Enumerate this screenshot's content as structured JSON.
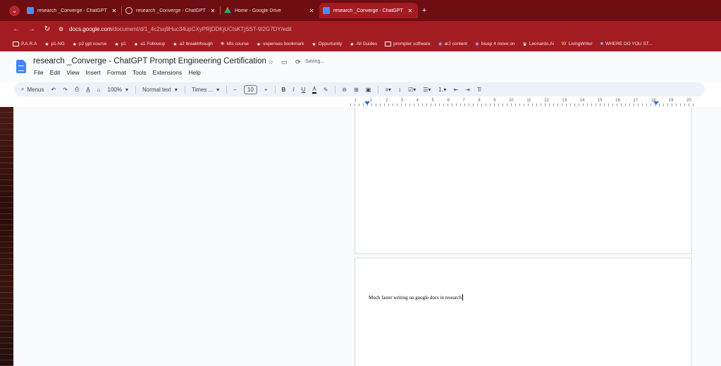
{
  "browser": {
    "tabs": [
      {
        "title": "research _Converge - ChatGPT",
        "icon": "docs-icon",
        "active": false
      },
      {
        "title": "research _Converge - ChatGPT",
        "icon": "globe-icon",
        "active": false
      },
      {
        "title": "Home - Google Drive",
        "icon": "drive-icon",
        "active": false
      },
      {
        "title": "research _Converge - ChatGPT",
        "icon": "docs-icon",
        "active": true
      }
    ],
    "new_tab_label": "+",
    "close_label": "✕",
    "url_host": "docs.google.com",
    "url_path": "/document/d/1_4c2sq9Huc34upCXyPRjDDKjUCtsKTjSST-9I2G7DY/edit",
    "bookmarks": [
      {
        "label": "P.A.R.A",
        "icon": "folder-icon"
      },
      {
        "label": "p1-NG",
        "icon": "star-icon"
      },
      {
        "label": "p2 gpt course",
        "icon": "star-icon"
      },
      {
        "label": "p1",
        "icon": "star-icon"
      },
      {
        "label": "a1 Followup",
        "icon": "star-icon"
      },
      {
        "label": "a2 breaktrhough",
        "icon": "star-icon"
      },
      {
        "label": "k8s course",
        "icon": "k8s-icon"
      },
      {
        "label": "expenses bookmark",
        "icon": "star-icon"
      },
      {
        "label": "Oppurtunity",
        "icon": "star-icon"
      },
      {
        "label": "All Guides",
        "icon": "star-icon"
      },
      {
        "label": "prompter software",
        "icon": "folder-icon"
      },
      {
        "label": "ar2 content",
        "icon": "gear-icon"
      },
      {
        "label": "bicep 4 move on",
        "icon": "gear-icon"
      },
      {
        "label": "Leonardo.Ai",
        "icon": "leonardo-icon"
      },
      {
        "label": "LivingWriter",
        "icon": "livingwriter-icon"
      },
      {
        "label": "WHERE DO YOU ST...",
        "icon": "chat-icon"
      }
    ]
  },
  "docs": {
    "title": "research _Converge -  ChatGPT Prompt  Engineering Certification",
    "status": "Saving...",
    "menu": [
      "File",
      "Edit",
      "View",
      "Insert",
      "Format",
      "Tools",
      "Extensions",
      "Help"
    ],
    "toolbar": {
      "search_label": "Menus",
      "zoom": "100%",
      "style": "Normal text",
      "font": "Times ...",
      "font_size": "10",
      "bold": "B",
      "italic": "I",
      "underline": "U",
      "text_color": "A"
    },
    "ruler_numbers": [
      "1",
      "1",
      "2",
      "3",
      "4",
      "5",
      "6",
      "7",
      "8",
      "9",
      "10",
      "11",
      "12",
      "13",
      "14",
      "15",
      "16",
      "17",
      "18",
      "19",
      "20"
    ],
    "body_text": "Much faster writing on google docs in research"
  },
  "colors": {
    "chrome_dark": "#6e0d12",
    "chrome_active": "#a31c22",
    "docs_blue": "#4285f4"
  }
}
